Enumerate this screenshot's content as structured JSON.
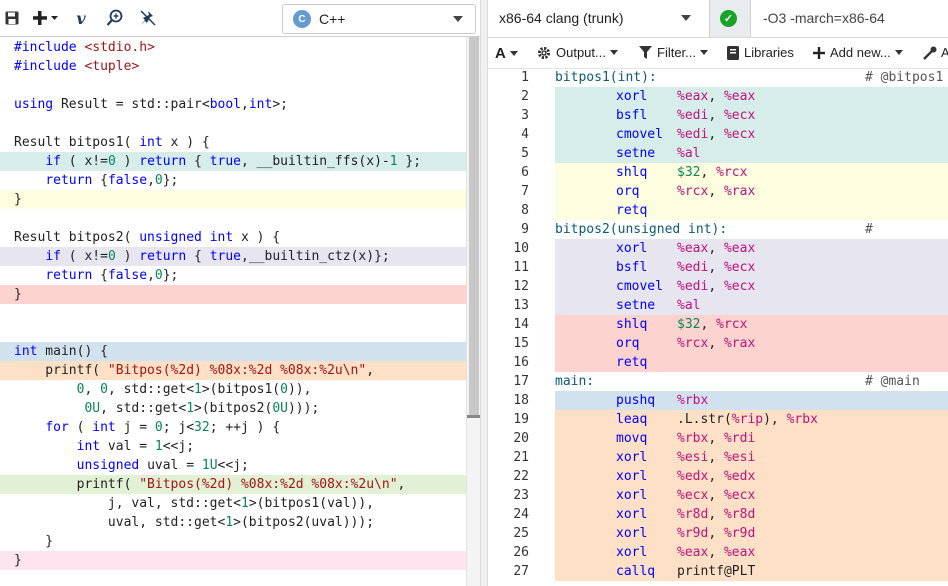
{
  "left_toolbar": {
    "language": "C++",
    "icons": [
      "save-icon",
      "add-icon",
      "vim-icon",
      "search-plus-icon",
      "readonly-icon"
    ]
  },
  "source_lines": [
    {
      "text": "#include <stdio.h>",
      "bg": ""
    },
    {
      "text": "#include <tuple>",
      "bg": ""
    },
    {
      "text": "",
      "bg": ""
    },
    {
      "text": "using Result = std::pair<bool,int>;",
      "bg": ""
    },
    {
      "text": "",
      "bg": ""
    },
    {
      "text": "Result bitpos1( int x ) {",
      "bg": ""
    },
    {
      "text": "    if ( x!=0 ) return { true, __builtin_ffs(x)-1 };",
      "bg": "#d6ede9"
    },
    {
      "text": "    return {false,0};",
      "bg": ""
    },
    {
      "text": "}",
      "bg": "#fdfde0"
    },
    {
      "text": "",
      "bg": ""
    },
    {
      "text": "Result bitpos2( unsigned int x ) {",
      "bg": ""
    },
    {
      "text": "    if ( x!=0 ) return { true,__builtin_ctz(x)};",
      "bg": "#e6e5f0"
    },
    {
      "text": "    return {false,0};",
      "bg": ""
    },
    {
      "text": "}",
      "bg": "#fdd3cf"
    },
    {
      "text": "",
      "bg": ""
    },
    {
      "text": "",
      "bg": ""
    },
    {
      "text": "int main() {",
      "bg": "#d2e1ee"
    },
    {
      "text": "    printf( \"Bitpos(%2d) %08x:%2d %08x:%2u\\n\",",
      "bg": "#fde0c6"
    },
    {
      "text": "        0, 0, std::get<1>(bitpos1(0)),",
      "bg": ""
    },
    {
      "text": "         0U, std::get<1>(bitpos2(0U)));",
      "bg": ""
    },
    {
      "text": "    for ( int j = 0; j<32; ++j ) {",
      "bg": ""
    },
    {
      "text": "        int val = 1<<j;",
      "bg": ""
    },
    {
      "text": "        unsigned uval = 1U<<j;",
      "bg": ""
    },
    {
      "text": "        printf( \"Bitpos(%2d) %08x:%2d %08x:%2u\\n\",",
      "bg": "#e2f0d6"
    },
    {
      "text": "            j, val, std::get<1>(bitpos1(val)),",
      "bg": ""
    },
    {
      "text": "            uval, std::get<1>(bitpos2(uval)));",
      "bg": ""
    },
    {
      "text": "    }",
      "bg": ""
    },
    {
      "text": "}",
      "bg": "#fde4ee"
    }
  ],
  "compiler": {
    "name": "x86-64 clang (trunk)",
    "options": "-O3 -march=x86-64"
  },
  "asm_toolbar": {
    "font_label": "A",
    "output_label": "Output...",
    "filter_label": "Filter...",
    "libraries_label": "Libraries",
    "add_new_label": "Add new...",
    "extra_label": "A"
  },
  "asm_lines": [
    {
      "n": "1",
      "label": "bitpos1(int):",
      "comment": "# @bitpos1",
      "op": "",
      "args": "",
      "bg": ""
    },
    {
      "n": "2",
      "label": "",
      "comment": "",
      "op": "xorl",
      "args": "%eax, %eax",
      "bg": "#d6ede9"
    },
    {
      "n": "3",
      "label": "",
      "comment": "",
      "op": "bsfl",
      "args": "%edi, %ecx",
      "bg": "#d6ede9"
    },
    {
      "n": "4",
      "label": "",
      "comment": "",
      "op": "cmovel",
      "args": "%edi, %ecx",
      "bg": "#d6ede9"
    },
    {
      "n": "5",
      "label": "",
      "comment": "",
      "op": "setne",
      "args": "%al",
      "bg": "#d6ede9"
    },
    {
      "n": "6",
      "label": "",
      "comment": "",
      "op": "shlq",
      "args": "$32, %rcx",
      "bg": "#fdfde0"
    },
    {
      "n": "7",
      "label": "",
      "comment": "",
      "op": "orq",
      "args": "%rcx, %rax",
      "bg": "#fdfde0"
    },
    {
      "n": "8",
      "label": "",
      "comment": "",
      "op": "retq",
      "args": "",
      "bg": "#fdfde0"
    },
    {
      "n": "9",
      "label": "bitpos2(unsigned int):",
      "comment": "#",
      "op": "",
      "args": "",
      "bg": ""
    },
    {
      "n": "10",
      "label": "",
      "comment": "",
      "op": "xorl",
      "args": "%eax, %eax",
      "bg": "#e6e5f0"
    },
    {
      "n": "11",
      "label": "",
      "comment": "",
      "op": "bsfl",
      "args": "%edi, %ecx",
      "bg": "#e6e5f0"
    },
    {
      "n": "12",
      "label": "",
      "comment": "",
      "op": "cmovel",
      "args": "%edi, %ecx",
      "bg": "#e6e5f0"
    },
    {
      "n": "13",
      "label": "",
      "comment": "",
      "op": "setne",
      "args": "%al",
      "bg": "#e6e5f0"
    },
    {
      "n": "14",
      "label": "",
      "comment": "",
      "op": "shlq",
      "args": "$32, %rcx",
      "bg": "#fdd3cf"
    },
    {
      "n": "15",
      "label": "",
      "comment": "",
      "op": "orq",
      "args": "%rcx, %rax",
      "bg": "#fdd3cf"
    },
    {
      "n": "16",
      "label": "",
      "comment": "",
      "op": "retq",
      "args": "",
      "bg": "#fdd3cf"
    },
    {
      "n": "17",
      "label": "main:",
      "comment": "# @main",
      "op": "",
      "args": "",
      "bg": ""
    },
    {
      "n": "18",
      "label": "",
      "comment": "",
      "op": "pushq",
      "args": "%rbx",
      "bg": "#d2e1ee"
    },
    {
      "n": "19",
      "label": "",
      "comment": "",
      "op": "leaq",
      "args": ".L.str(%rip), %rbx",
      "bg": "#fde0c6"
    },
    {
      "n": "20",
      "label": "",
      "comment": "",
      "op": "movq",
      "args": "%rbx, %rdi",
      "bg": "#fde0c6"
    },
    {
      "n": "21",
      "label": "",
      "comment": "",
      "op": "xorl",
      "args": "%esi, %esi",
      "bg": "#fde0c6"
    },
    {
      "n": "22",
      "label": "",
      "comment": "",
      "op": "xorl",
      "args": "%edx, %edx",
      "bg": "#fde0c6"
    },
    {
      "n": "23",
      "label": "",
      "comment": "",
      "op": "xorl",
      "args": "%ecx, %ecx",
      "bg": "#fde0c6"
    },
    {
      "n": "24",
      "label": "",
      "comment": "",
      "op": "xorl",
      "args": "%r8d, %r8d",
      "bg": "#fde0c6"
    },
    {
      "n": "25",
      "label": "",
      "comment": "",
      "op": "xorl",
      "args": "%r9d, %r9d",
      "bg": "#fde0c6"
    },
    {
      "n": "26",
      "label": "",
      "comment": "",
      "op": "xorl",
      "args": "%eax, %eax",
      "bg": "#fde0c6"
    },
    {
      "n": "27",
      "label": "",
      "comment": "",
      "op": "callq",
      "args": "printf@PLT",
      "bg": "#fde0c6"
    }
  ],
  "colors": {
    "ok": "#1aa32a",
    "label": "#0d5a77",
    "opcode": "#0000ff",
    "register": "#c1117a"
  }
}
